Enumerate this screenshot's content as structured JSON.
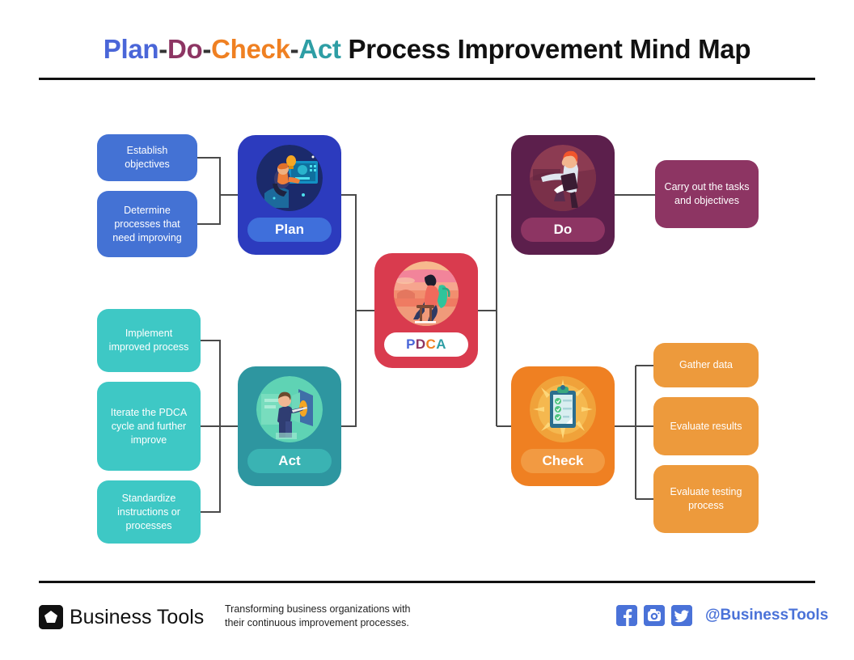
{
  "header": {
    "title_parts": [
      {
        "text": "Plan",
        "cls": "w-plan"
      },
      {
        "text": "-",
        "cls": "w-dash"
      },
      {
        "text": "Do",
        "cls": "w-do"
      },
      {
        "text": "-",
        "cls": "w-dash"
      },
      {
        "text": "Check",
        "cls": "w-check"
      },
      {
        "text": "-",
        "cls": "w-dash"
      },
      {
        "text": "Act",
        "cls": "w-act"
      },
      {
        "text": " Process Improvement Mind Map",
        "cls": "w-rest"
      }
    ],
    "title_plain": "Plan-Do-Check-Act Process Improvement Mind Map"
  },
  "center": {
    "label": "PDCA",
    "letters": [
      "P",
      "D",
      "C",
      "A"
    ],
    "color": "#d93b4e",
    "illustration": "person-sitting-sunset-icon"
  },
  "nodes": {
    "plan": {
      "label": "Plan",
      "color": "#2c3bbe",
      "pill_color": "#3f6fdb",
      "illustration": "person-at-computer-idea-icon",
      "children": [
        "Establish objectives",
        "Determine processes that need improving"
      ],
      "child_color": "#4472d4"
    },
    "do": {
      "label": "Do",
      "color": "#5c1f4c",
      "pill_color": "#8d3563",
      "illustration": "person-carrying-box-icon",
      "children": [
        "Carry out the tasks and objectives"
      ],
      "child_color": "#8d3563"
    },
    "check": {
      "label": "Check",
      "color": "#ef8022",
      "pill_color": "#f29a42",
      "illustration": "clipboard-checklist-icon",
      "children": [
        "Gather data",
        "Evaluate results",
        "Evaluate testing process"
      ],
      "child_color": "#ed9a3c"
    },
    "act": {
      "label": "Act",
      "color": "#2e96a0",
      "pill_color": "#3ab3b3",
      "illustration": "person-presenting-board-icon",
      "children": [
        "Implement improved process",
        "Iterate the PDCA cycle and further improve",
        "Standardize instructions or processes"
      ],
      "child_color": "#3ec8c5"
    }
  },
  "footer": {
    "brand": "Business Tools",
    "logo_icon": "pentagon-logo-icon",
    "tagline": "Transforming business organizations with their continuous improvement processes.",
    "handle": "@BusinessTools",
    "social": [
      {
        "name": "facebook-icon",
        "glyph": "f"
      },
      {
        "name": "instagram-icon",
        "glyph": "◎"
      },
      {
        "name": "twitter-icon",
        "glyph": "ᴠ"
      }
    ],
    "social_color": "#4a72d8"
  }
}
